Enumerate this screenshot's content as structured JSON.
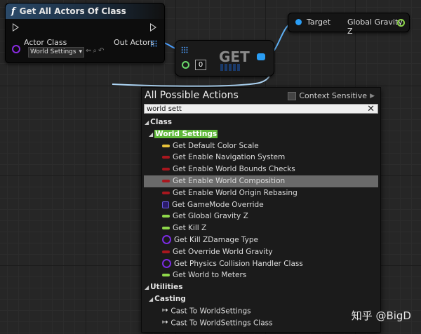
{
  "nodes": {
    "get_all_actors": {
      "title": "Get All Actors Of Class",
      "actor_class_label": "Actor Class",
      "actor_class_value": "World Settings",
      "out_actors_label": "Out Actors"
    },
    "get": {
      "title": "GET",
      "index_value": "0"
    },
    "target": {
      "target_label": "Target",
      "output_label": "Global Gravity Z"
    }
  },
  "menu": {
    "title": "All Possible Actions",
    "context_sensitive_label": "Context Sensitive",
    "search_value": "world sett",
    "items": [
      {
        "kind": "cat",
        "indent": 0,
        "label": "Class"
      },
      {
        "kind": "cat",
        "indent": 1,
        "label": "World Settings",
        "highlight": true
      },
      {
        "kind": "item",
        "label": "Get Default Color Scale",
        "icon": "bar",
        "color": "#e8c23a"
      },
      {
        "kind": "item",
        "label": "Get Enable Navigation System",
        "icon": "bar",
        "color": "#a8171e"
      },
      {
        "kind": "item",
        "label": "Get Enable World Bounds Checks",
        "icon": "bar",
        "color": "#a8171e"
      },
      {
        "kind": "item",
        "label": "Get Enable World Composition",
        "icon": "bar",
        "color": "#a8171e",
        "selected": true
      },
      {
        "kind": "item",
        "label": "Get Enable World Origin Rebasing",
        "icon": "bar",
        "color": "#a8171e"
      },
      {
        "kind": "item",
        "label": "Get GameMode Override",
        "icon": "sq",
        "color": "#6a5ae2"
      },
      {
        "kind": "item",
        "label": "Get Global Gravity Z",
        "icon": "bar",
        "color": "#8ed84a"
      },
      {
        "kind": "item",
        "label": "Get Kill Z",
        "icon": "bar",
        "color": "#8ed84a"
      },
      {
        "kind": "item",
        "label": "Get Kill ZDamage Type",
        "icon": "ring",
        "color": "#7a2be2"
      },
      {
        "kind": "item",
        "label": "Get Override World Gravity",
        "icon": "bar",
        "color": "#a8171e"
      },
      {
        "kind": "item",
        "label": "Get Physics Collision Handler Class",
        "icon": "ring",
        "color": "#7a2be2"
      },
      {
        "kind": "item",
        "label": "Get World to Meters",
        "icon": "bar",
        "color": "#8ed84a"
      },
      {
        "kind": "cat",
        "indent": 0,
        "label": "Utilities"
      },
      {
        "kind": "cat",
        "indent": 1,
        "label": "Casting"
      },
      {
        "kind": "item",
        "label": "Cast To WorldSettings",
        "icon": "arrow"
      },
      {
        "kind": "item",
        "label": "Cast To WorldSettings Class",
        "icon": "arrow"
      }
    ]
  },
  "watermark": "知乎 @BigD"
}
